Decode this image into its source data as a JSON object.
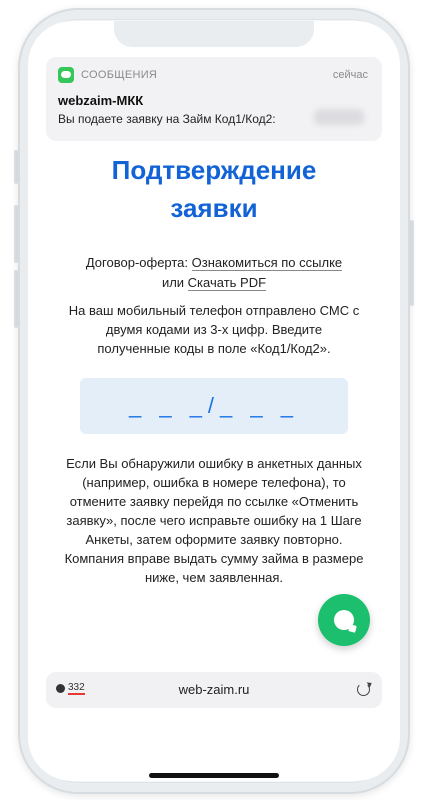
{
  "notification": {
    "app_name": "СООБЩЕНИЯ",
    "icon": "messages-icon",
    "time": "сейчас",
    "sender": "webzaim-МКК",
    "text": "Вы подаете заявку на Займ Код1/Код2:"
  },
  "page": {
    "title_line1": "Подтверждение",
    "title_line2": "заявки",
    "offer_prefix": "Договор-оферта: ",
    "offer_link": "Ознакомиться по ссылке",
    "offer_or": "или ",
    "offer_pdf": "Скачать PDF",
    "info_text": "На ваш мобильный телефон отправлено СМС с двумя кодами из 3-х цифр. Введите полученные коды в поле «Код1/Код2».",
    "code_placeholder": "_ _ _/_ _ _",
    "warning_text": "Если Вы обнаружили ошибку в анкетных данных (например, ошибка в номере телефона), то отмените заявку перейдя по ссылке «Отменить заявку», после чего исправьте ошибку на 1 Шаге Анкеты, затем оформите заявку повторно. Компания вправе выдать сумму займа в размере ниже, чем заявленная."
  },
  "chat_button": {
    "icon": "chat-bubble-icon"
  },
  "browser": {
    "badge_count": "332",
    "url": "web-zaim.ru",
    "reload_icon": "reload-icon"
  },
  "colors": {
    "accent": "#1263d6",
    "chat": "#1cbf6e",
    "code_bg": "#e3eef9"
  }
}
